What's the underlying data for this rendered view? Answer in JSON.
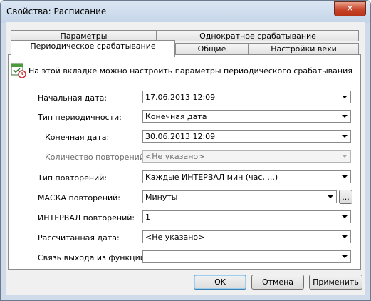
{
  "window": {
    "title": "Свойства: Расписание",
    "close": "✕"
  },
  "tabs": {
    "row1": [
      "Параметры",
      "Однократное срабатывание"
    ],
    "row2": [
      "Периодическое срабатывание",
      "Общие",
      "Настройки вехи"
    ],
    "active": "Периодическое срабатывание"
  },
  "info": "На этой вкладке можно настроить параметры периодического срабатывания",
  "fields": [
    {
      "label": "Начальная дата:",
      "value": "17.06.2013 12:09",
      "disabled": false
    },
    {
      "label": "Тип периодичности:",
      "value": "Конечная дата",
      "disabled": false
    },
    {
      "label": "Конечная дата:",
      "value": "30.06.2013 12:09",
      "disabled": false
    },
    {
      "label": "Количество повторений:",
      "value": "<Не указано>",
      "disabled": true
    },
    {
      "label": "Тип повторений:",
      "value": "Каждые ИНТЕРВАЛ мин (час, ...)",
      "disabled": false
    },
    {
      "label": "МАСКА повторений:",
      "value": "Минуты",
      "disabled": false,
      "ellipsis": "..."
    },
    {
      "label": "ИНТЕРВАЛ повторений:",
      "value": "1",
      "disabled": false
    },
    {
      "label": "Рассчитанная дата:",
      "value": "<Не указано>",
      "disabled": false
    },
    {
      "label": "Связь выхода из функции:",
      "value": "",
      "disabled": false
    }
  ],
  "buttons": {
    "ok": "OK",
    "cancel": "Отмена",
    "apply": "Применить"
  },
  "icons": {
    "info": "calendar-clock-icon",
    "close": "close-icon",
    "dropdown": "chevron-down-icon"
  }
}
